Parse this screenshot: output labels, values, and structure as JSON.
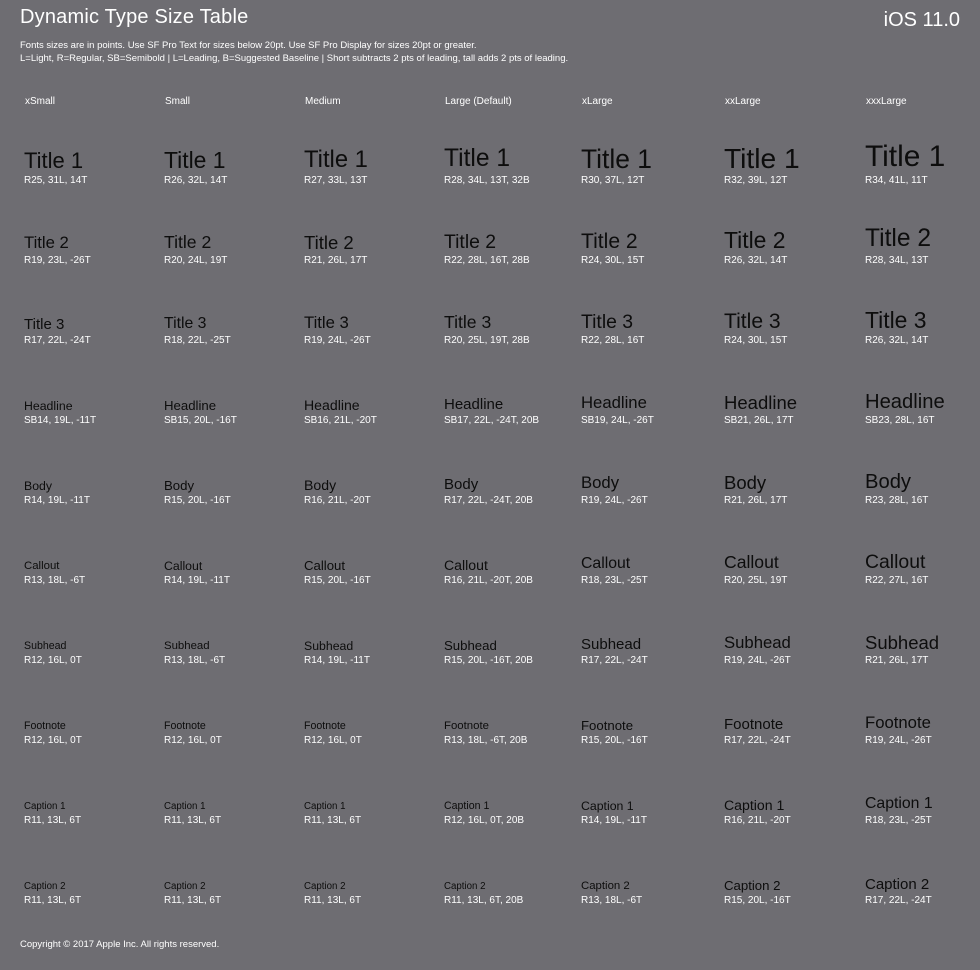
{
  "header": {
    "title": "Dynamic Type Size Table",
    "version": "iOS 11.0",
    "notes": [
      "Fonts sizes are in points. Use SF Pro Text for sizes below 20pt. Use SF Pro Display for sizes 20pt or greater.",
      "L=Light, R=Regular, SB=Semibold | L=Leading, B=Suggested Baseline | Short subtracts 2 pts of leading, tall adds 2 pts of leading."
    ]
  },
  "columns": [
    "xSmall",
    "Small",
    "Medium",
    "Large (Default)",
    "xLarge",
    "xxLarge",
    "xxxLarge"
  ],
  "rows": [
    {
      "style": "Title 1",
      "sizes": [
        25,
        26,
        27,
        28,
        30,
        32,
        34
      ],
      "specs": [
        "R25, 31L, 14T",
        "R26, 32L, 14T",
        "R27, 33L, 13T",
        "R28, 34L, 13T, 32B",
        "R30, 37L, 12T",
        "R32, 39L, 12T",
        "R34, 41L, 11T"
      ]
    },
    {
      "style": "Title 2",
      "sizes": [
        19,
        20,
        21,
        22,
        24,
        26,
        28
      ],
      "specs": [
        "R19, 23L, -26T",
        "R20, 24L, 19T",
        "R21, 26L, 17T",
        "R22, 28L, 16T, 28B",
        "R24, 30L, 15T",
        "R26, 32L, 14T",
        "R28, 34L, 13T"
      ]
    },
    {
      "style": "Title 3",
      "sizes": [
        17,
        18,
        19,
        20,
        22,
        24,
        26
      ],
      "specs": [
        "R17, 22L, -24T",
        "R18, 22L, -25T",
        "R19, 24L, -26T",
        "R20, 25L, 19T, 28B",
        "R22, 28L, 16T",
        "R24, 30L, 15T",
        "R26, 32L, 14T"
      ]
    },
    {
      "style": "Headline",
      "sizes": [
        14,
        15,
        16,
        17,
        19,
        21,
        23
      ],
      "specs": [
        "SB14, 19L, -11T",
        "SB15, 20L, -16T",
        "SB16, 21L, -20T",
        "SB17, 22L, -24T, 20B",
        "SB19, 24L, -26T",
        "SB21, 26L, 17T",
        "SB23, 28L, 16T"
      ]
    },
    {
      "style": "Body",
      "sizes": [
        14,
        15,
        16,
        17,
        19,
        21,
        23
      ],
      "specs": [
        "R14, 19L, -11T",
        "R15, 20L, -16T",
        "R16, 21L, -20T",
        "R17, 22L, -24T,  20B",
        "R19, 24L, -26T",
        "R21, 26L, 17T",
        "R23, 28L, 16T"
      ]
    },
    {
      "style": "Callout",
      "sizes": [
        13,
        14,
        15,
        16,
        18,
        20,
        22
      ],
      "specs": [
        "R13, 18L, -6T",
        "R14, 19L, -11T",
        "R15, 20L, -16T",
        "R16, 21L, -20T, 20B",
        "R18, 23L, -25T",
        "R20, 25L, 19T",
        "R22, 27L, 16T"
      ]
    },
    {
      "style": "Subhead",
      "sizes": [
        12,
        13,
        14,
        15,
        17,
        19,
        21
      ],
      "specs": [
        "R12, 16L, 0T",
        "R13, 18L, -6T",
        "R14, 19L, -11T",
        "R15, 20L, -16T, 20B",
        "R17, 22L, -24T",
        "R19, 24L, -26T",
        "R21, 26L, 17T"
      ]
    },
    {
      "style": "Footnote",
      "sizes": [
        12,
        12,
        12,
        13,
        15,
        17,
        19
      ],
      "specs": [
        "R12, 16L, 0T",
        "R12, 16L, 0T",
        "R12, 16L, 0T",
        "R13, 18L, -6T, 20B",
        "R15, 20L, -16T",
        "R17, 22L, -24T",
        "R19, 24L, -26T"
      ]
    },
    {
      "style": "Caption 1",
      "sizes": [
        11,
        11,
        11,
        12,
        14,
        16,
        18
      ],
      "specs": [
        "R11, 13L, 6T",
        "R11, 13L, 6T",
        "R11, 13L, 6T",
        "R12, 16L, 0T, 20B",
        "R14, 19L, -11T",
        "R16, 21L, -20T",
        "R18, 23L, -25T"
      ]
    },
    {
      "style": "Caption 2",
      "sizes": [
        11,
        11,
        11,
        11,
        13,
        15,
        17
      ],
      "specs": [
        "R11, 13L, 6T",
        "R11, 13L, 6T",
        "R11, 13L, 6T",
        "R11, 13L, 6T, 20B",
        "R13, 18L, -6T",
        "R15, 20L, -16T",
        "R17, 22L, -24T"
      ]
    }
  ],
  "footer": {
    "copyright": "Copyright © 2017 Apple Inc. All rights reserved."
  },
  "colors": {
    "background": "#6e6d72",
    "style_text": "#0d0d0d",
    "spec_text": "#ffffff"
  }
}
